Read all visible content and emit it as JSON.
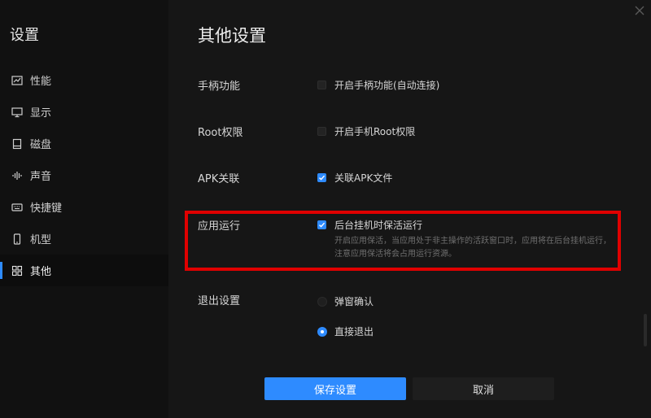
{
  "sidebar": {
    "title": "设置",
    "items": [
      {
        "label": "性能",
        "icon": "chart-icon"
      },
      {
        "label": "显示",
        "icon": "monitor-icon"
      },
      {
        "label": "磁盘",
        "icon": "disk-icon"
      },
      {
        "label": "声音",
        "icon": "sound-icon"
      },
      {
        "label": "快捷键",
        "icon": "keyboard-icon"
      },
      {
        "label": "机型",
        "icon": "phone-icon"
      },
      {
        "label": "其他",
        "icon": "grid-icon",
        "active": true
      }
    ]
  },
  "main": {
    "title": "其他设置",
    "gamepad": {
      "label": "手柄功能",
      "option": "开启手柄功能(自动连接)",
      "checked": false
    },
    "root": {
      "label": "Root权限",
      "option": "开启手机Root权限",
      "checked": false
    },
    "apk": {
      "label": "APK关联",
      "option": "关联APK文件",
      "checked": true
    },
    "app_run": {
      "label": "应用运行",
      "option": "后台挂机时保活运行",
      "checked": true,
      "description": "开启应用保活，当应用处于非主操作的活跃窗口时，应用将在后台挂机运行，注意应用保活将会占用运行资源。"
    },
    "exit": {
      "label": "退出设置",
      "options": [
        {
          "label": "弹窗确认",
          "selected": false
        },
        {
          "label": "直接退出",
          "selected": true
        }
      ]
    },
    "buttons": {
      "save": "保存设置",
      "cancel": "取消"
    }
  },
  "colors": {
    "accent": "#2e8bff",
    "highlight": "#e00000",
    "background": "#161616",
    "sidebar": "#111111"
  }
}
